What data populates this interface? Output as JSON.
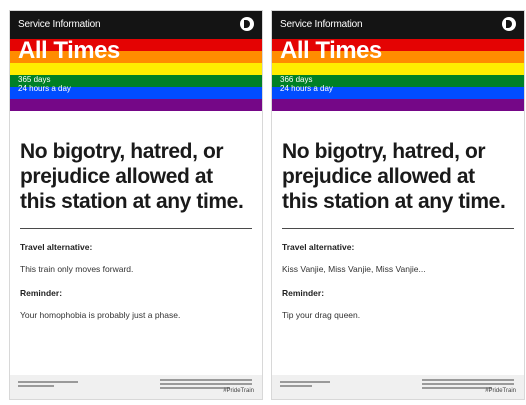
{
  "colors": {
    "header": "#141414",
    "stripes": [
      "#e40303",
      "#ff8c00",
      "#ffed00",
      "#008026",
      "#004dff",
      "#750787"
    ]
  },
  "posters": [
    {
      "service_label": "Service Information",
      "logo_icon": "transit-logo-icon",
      "title": "All Times",
      "days": "365 days",
      "hours": "24 hours a day",
      "message": "No bigotry, hatred, or prejudice allowed at this station at any time.",
      "travel_label": "Travel alternative:",
      "travel_value": "This train only moves forward.",
      "reminder_label": "Reminder:",
      "reminder_value": "Your homophobia is probably just a phase.",
      "hashtag": "#PrideTrain"
    },
    {
      "service_label": "Service Information",
      "logo_icon": "transit-logo-icon",
      "title": "All Times",
      "days": "366 days",
      "hours": "24 hours a day",
      "message": "No bigotry, hatred, or prejudice allowed at this station at any time.",
      "travel_label": "Travel alternative:",
      "travel_value": "Kiss Vanjie, Miss Vanjie, Miss Vanjie...",
      "reminder_label": "Reminder:",
      "reminder_value": "Tip your drag queen.",
      "hashtag": "#PrideTrain"
    }
  ]
}
